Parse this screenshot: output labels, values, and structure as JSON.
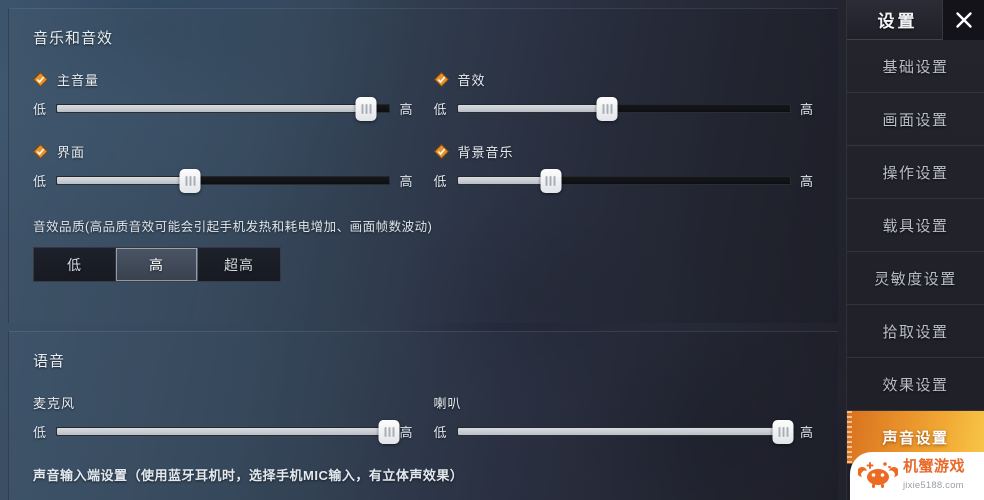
{
  "audio_section": {
    "title": "音乐和音效",
    "sliders": [
      {
        "label": "主音量",
        "low": "低",
        "high": "高",
        "value": 93,
        "icon": "check-diamond-icon"
      },
      {
        "label": "音效",
        "low": "低",
        "high": "高",
        "value": 45,
        "icon": "check-diamond-icon"
      },
      {
        "label": "界面",
        "low": "低",
        "high": "高",
        "value": 40,
        "icon": "check-diamond-icon"
      },
      {
        "label": "背景音乐",
        "low": "低",
        "high": "高",
        "value": 28,
        "icon": "check-diamond-icon"
      }
    ],
    "quality": {
      "caption": "音效品质(高品质音效可能会引起手机发热和耗电增加、画面帧数波动)",
      "options": [
        "低",
        "高",
        "超高"
      ],
      "selected": "高"
    }
  },
  "voice_section": {
    "title": "语音",
    "sliders": [
      {
        "label": "麦克风",
        "low": "低",
        "high": "高",
        "value": 100
      },
      {
        "label": "喇叭",
        "low": "低",
        "high": "高",
        "value": 98
      }
    ],
    "footnote": "声音输入端设置（使用蓝牙耳机时，选择手机MIC输入，有立体声效果）"
  },
  "sidebar": {
    "title": "设置",
    "close_icon": "close-icon",
    "items": [
      {
        "label": "基础设置",
        "active": false
      },
      {
        "label": "画面设置",
        "active": false
      },
      {
        "label": "操作设置",
        "active": false
      },
      {
        "label": "载具设置",
        "active": false
      },
      {
        "label": "灵敏度设置",
        "active": false
      },
      {
        "label": "拾取设置",
        "active": false
      },
      {
        "label": "效果设置",
        "active": false
      },
      {
        "label": "声音设置",
        "active": true
      }
    ]
  },
  "watermark": {
    "logo_icon": "crab-logo-icon",
    "name": "机蟹游戏",
    "url": "jixie5188.com"
  },
  "colors": {
    "accent_orange": "#e8902a",
    "panel_blue": "#37485a",
    "panel_dark": "#23242f",
    "diamond_orange": "#e8932d"
  }
}
